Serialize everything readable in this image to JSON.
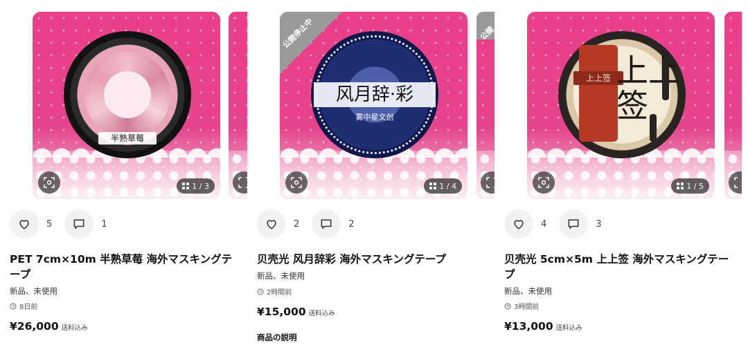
{
  "listings": [
    {
      "likes": "5",
      "comments": "1",
      "title": "PET 7cm×10m 半熟草莓 海外マスキングテープ",
      "condition": "新品、未使用",
      "posted": "8日前",
      "price": "¥26,000",
      "shipping": "送料込み",
      "image_counter": "1 / 3",
      "tape_label": "半熟草莓"
    },
    {
      "likes": "2",
      "comments": "2",
      "title": "贝壳光 风月辞彩 海外マスキングテープ",
      "condition": "新品、未使用",
      "posted": "2時間前",
      "price": "¥15,000",
      "shipping": "送料込み",
      "image_counter": "1 / 4",
      "status_ribbon": "公開停止中",
      "tape_label": "风月辞·彩",
      "tape_sub": "雾中星文创",
      "description_heading": "商品の説明"
    },
    {
      "likes": "4",
      "comments": "3",
      "title": "贝壳光 5cm×5m 上上签 海外マスキングテープ",
      "condition": "新品、未使用",
      "posted": "3時間前",
      "price": "¥13,000",
      "shipping": "送料込み",
      "image_counter": "1 / 5",
      "tape_label": "上上签",
      "tape_big": "上上签"
    }
  ],
  "neighbor_ribbon": "公開",
  "icons": {
    "like": "heart-icon",
    "comment": "comment-icon",
    "zoom": "lens-scan-icon",
    "gallery": "grid-icon",
    "time": "clock-icon"
  },
  "colors": {
    "thumb_background": "#e5448c",
    "ribbon": "#9a9a9a",
    "action_bg": "#f2f2f2"
  }
}
